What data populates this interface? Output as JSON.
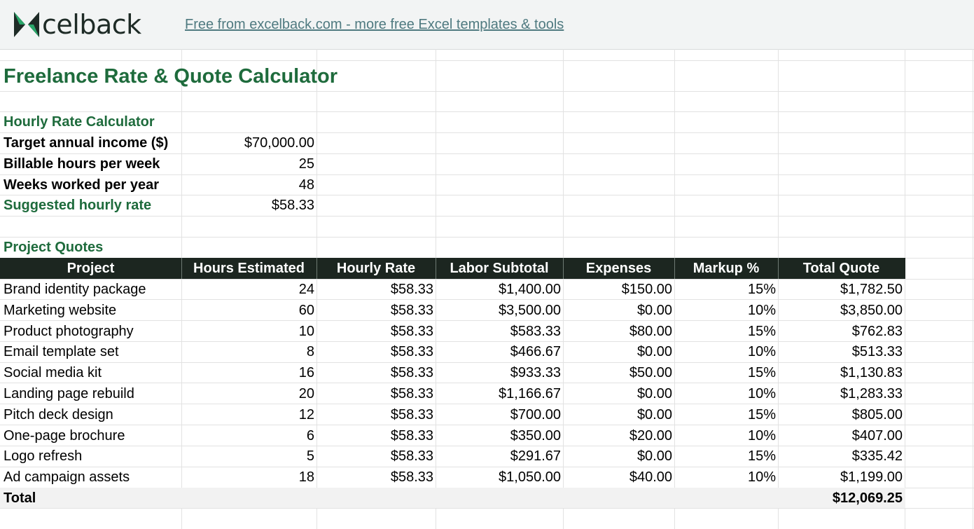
{
  "header": {
    "logo_text": "celback",
    "link_text": "Free from excelback.com - more free Excel templates & tools"
  },
  "sheet": {
    "title": "Freelance Rate & Quote Calculator",
    "rate_section": {
      "heading": "Hourly Rate Calculator",
      "rows": [
        {
          "label": "Target annual income ($)",
          "value": "$70,000.00"
        },
        {
          "label": "Billable hours per week",
          "value": "25"
        },
        {
          "label": "Weeks worked per year",
          "value": "48"
        }
      ],
      "result_label": "Suggested hourly rate",
      "result_value": "$58.33"
    },
    "quotes_section": {
      "heading": "Project Quotes",
      "columns": [
        "Project",
        "Hours Estimated",
        "Hourly Rate",
        "Labor Subtotal",
        "Expenses",
        "Markup %",
        "Total Quote"
      ],
      "rows": [
        [
          "Brand identity package",
          "24",
          "$58.33",
          "$1,400.00",
          "$150.00",
          "15%",
          "$1,782.50"
        ],
        [
          "Marketing website",
          "60",
          "$58.33",
          "$3,500.00",
          "$0.00",
          "10%",
          "$3,850.00"
        ],
        [
          "Product photography",
          "10",
          "$58.33",
          "$583.33",
          "$80.00",
          "15%",
          "$762.83"
        ],
        [
          "Email template set",
          "8",
          "$58.33",
          "$466.67",
          "$0.00",
          "10%",
          "$513.33"
        ],
        [
          "Social media kit",
          "16",
          "$58.33",
          "$933.33",
          "$50.00",
          "15%",
          "$1,130.83"
        ],
        [
          "Landing page rebuild",
          "20",
          "$58.33",
          "$1,166.67",
          "$0.00",
          "10%",
          "$1,283.33"
        ],
        [
          "Pitch deck design",
          "12",
          "$58.33",
          "$700.00",
          "$0.00",
          "15%",
          "$805.00"
        ],
        [
          "One-page brochure",
          "6",
          "$58.33",
          "$350.00",
          "$20.00",
          "10%",
          "$407.00"
        ],
        [
          "Logo refresh",
          "5",
          "$58.33",
          "$291.67",
          "$0.00",
          "15%",
          "$335.42"
        ],
        [
          "Ad campaign assets",
          "18",
          "$58.33",
          "$1,050.00",
          "$40.00",
          "10%",
          "$1,199.00"
        ]
      ],
      "total_label": "Total",
      "total_value": "$12,069.25"
    }
  },
  "colors": {
    "accent_green": "#1e6b3c",
    "header_dark": "#1c2620",
    "link": "#4f7a80"
  }
}
